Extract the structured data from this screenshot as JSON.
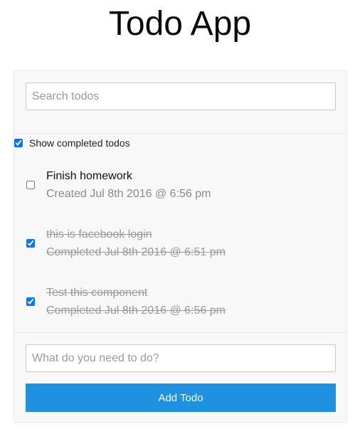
{
  "app": {
    "title": "Todo App"
  },
  "search": {
    "placeholder": "Search todos",
    "value": ""
  },
  "filter": {
    "show_completed_label": "Show completed todos",
    "show_completed_checked": true
  },
  "todos": [
    {
      "text": "Finish homework",
      "meta": "Created Jul 8th 2016 @ 6:56 pm",
      "completed": false
    },
    {
      "text": "this is facebook login",
      "meta": "Completed Jul 8th 2016 @ 6:51 pm",
      "completed": true
    },
    {
      "text": "Test this component",
      "meta": "Completed Jul 8th 2016 @ 6:56 pm",
      "completed": true
    }
  ],
  "add_todo": {
    "placeholder": "What do you need to do?",
    "value": "",
    "button_label": "Add Todo"
  },
  "colors": {
    "accent": "#1e92e0",
    "card_bg": "#f8f8f8",
    "muted_text": "#9a9a9a"
  }
}
